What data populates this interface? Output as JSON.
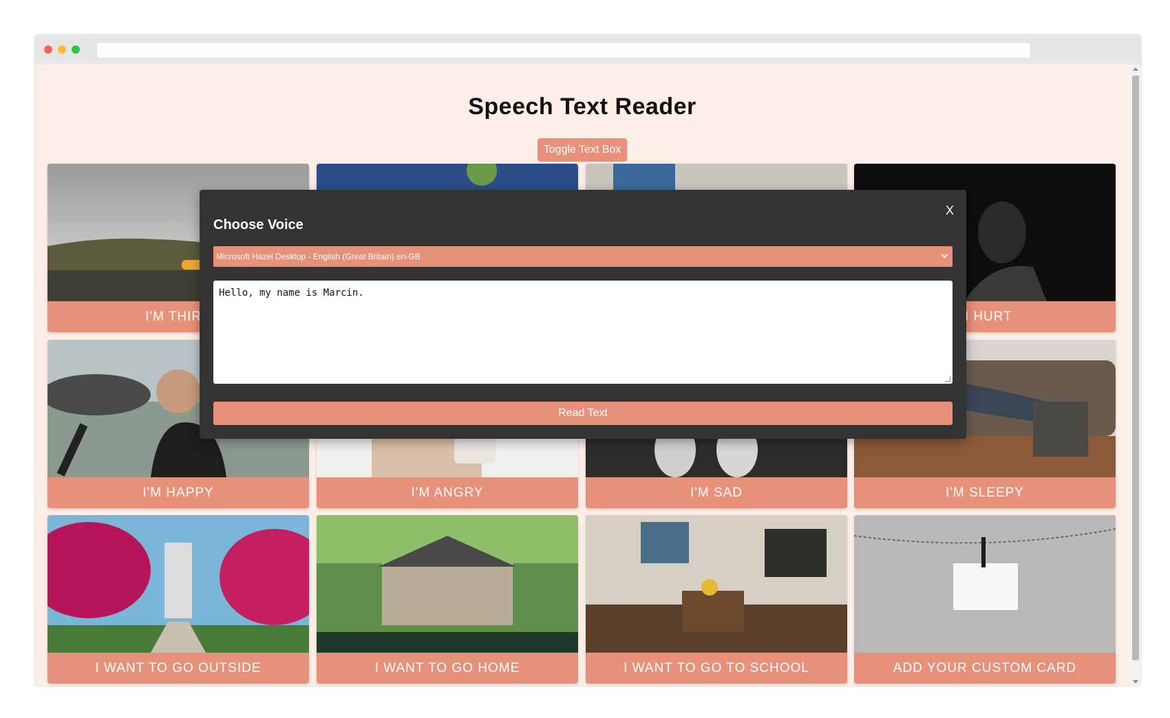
{
  "page": {
    "title": "Speech Text Reader",
    "toggle_label": "Toggle Text Box"
  },
  "cards": [
    {
      "label": "I'm Thirsty",
      "visible_label": "I'M THIRS",
      "icon": "lake-photo"
    },
    {
      "label": "",
      "visible_label": "",
      "icon": "person-blue-shirt-photo"
    },
    {
      "label": "",
      "visible_label": "",
      "icon": "person-hood-photo"
    },
    {
      "label": "I'm Hurt",
      "visible_label": "M HURT",
      "icon": "sad-man-dark-photo"
    },
    {
      "label": "I'm Happy",
      "visible_label": "I'M HAPPY",
      "icon": "happy-man-headphones-photo"
    },
    {
      "label": "I'm Angry",
      "visible_label": "I'M ANGRY",
      "icon": "office-phone-photo"
    },
    {
      "label": "I'm Sad",
      "visible_label": "I'M SAD",
      "icon": "dark-hands-photo"
    },
    {
      "label": "I'm Sleepy",
      "visible_label": "I'M SLEEPY",
      "icon": "man-sleeping-couch-photo"
    },
    {
      "label": "I Want To Go Outside",
      "visible_label": "I WANT TO GO OUTSIDE",
      "icon": "pink-trees-park-photo"
    },
    {
      "label": "I Want To Go Home",
      "visible_label": "I WANT TO GO HOME",
      "icon": "house-photo"
    },
    {
      "label": "I Want To Go To School",
      "visible_label": "I WANT TO GO TO SCHOOL",
      "icon": "classroom-photo"
    },
    {
      "label": "Add Your Custom Card",
      "visible_label": "ADD YOUR CUSTOM CARD",
      "icon": "blank-note-clip-photo"
    }
  ],
  "modal": {
    "close_label": "X",
    "title": "Choose Voice",
    "selected_voice": "Microsoft Hazel Desktop - English (Great Britain) en-GB",
    "text_value": "Hello, my name is Marcin.",
    "read_label": "Read Text"
  },
  "colors": {
    "accent": "#e8917a",
    "page_bg": "#fdeee8",
    "modal_bg": "#333333"
  }
}
